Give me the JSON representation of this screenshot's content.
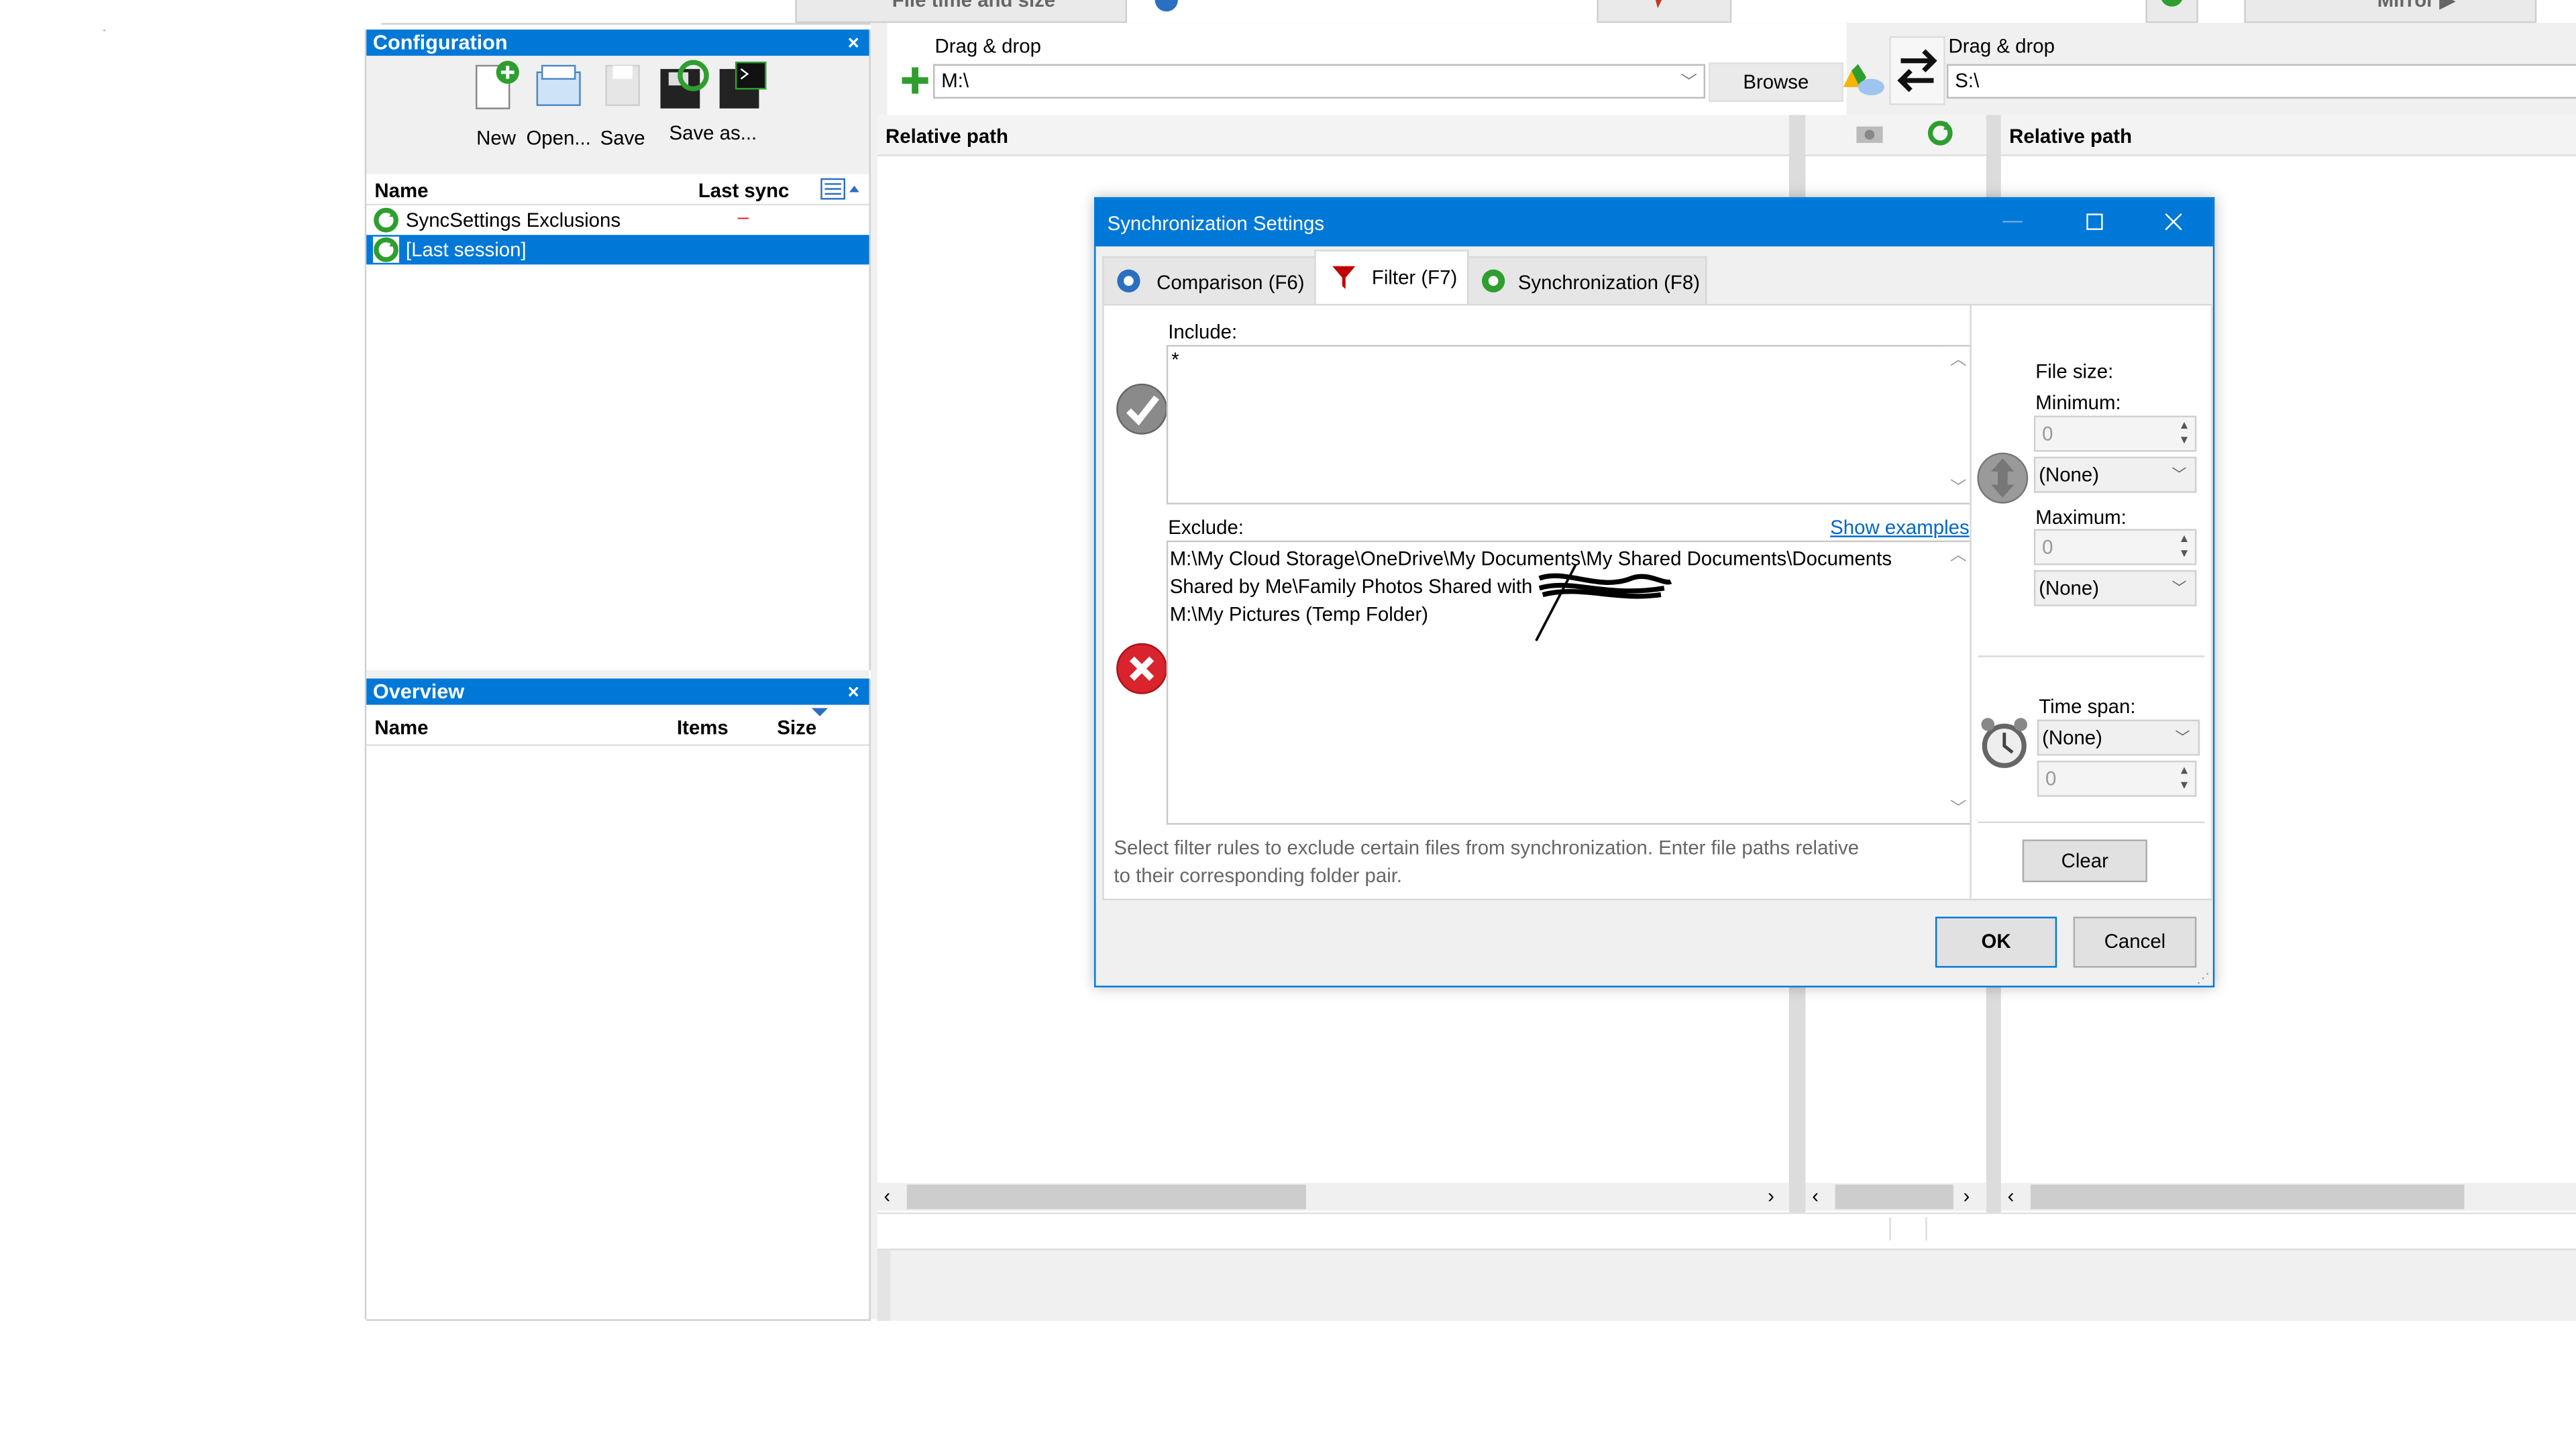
{
  "configuration": {
    "title": "Configuration",
    "close": "×",
    "toolbar": {
      "new": "New",
      "open": "Open...",
      "save": "Save",
      "save_as": "Save as..."
    },
    "columns": {
      "name": "Name",
      "last_sync": "Last sync"
    },
    "items": [
      {
        "name": "SyncSettings Exclusions",
        "last_sync": "–"
      },
      {
        "name": "[Last session]",
        "last_sync": ""
      }
    ]
  },
  "overview": {
    "title": "Overview",
    "close": "×",
    "columns": {
      "name": "Name",
      "items": "Items",
      "size": "Size"
    }
  },
  "top_toolbar": {
    "compare_variant": "File time and size",
    "sync_variant": "Mirror ▶"
  },
  "folder_left": {
    "drag_label": "Drag & drop",
    "path": "M:\\",
    "browse": "Browse"
  },
  "folder_right": {
    "drag_label": "Drag & drop",
    "path": "S:\\"
  },
  "grid": {
    "left_header": "Relative path",
    "right_header": "Relative path"
  },
  "dialog": {
    "title": "Synchronization Settings",
    "tabs": [
      "Comparison (F6)",
      "Filter (F7)",
      "Synchronization (F8)"
    ],
    "include_label": "Include:",
    "include_text": "*",
    "exclude_label": "Exclude:",
    "show_examples": "Show examples",
    "exclude_lines": [
      "M:\\My Cloud Storage\\OneDrive\\My Documents\\My Shared Documents\\Documents",
      "Shared by Me\\Family Photos Shared with",
      "M:\\My Pictures (Temp Folder)"
    ],
    "hint_line1": "Select filter rules to exclude certain files from synchronization. Enter file paths relative",
    "hint_line2": "to their corresponding folder pair.",
    "file_size_label": "File size:",
    "minimum_label": "Minimum:",
    "minimum_value": "0",
    "minimum_unit": "(None)",
    "maximum_label": "Maximum:",
    "maximum_value": "0",
    "maximum_unit": "(None)",
    "time_span_label": "Time span:",
    "time_span_value": "(None)",
    "time_span_number": "0",
    "clear": "Clear",
    "ok": "OK",
    "cancel": "Cancel"
  },
  "colors": {
    "accent": "#0078d7",
    "sync_green": "#2e9e2e",
    "error_red": "#d9232d",
    "filter_red": "#c00000"
  }
}
